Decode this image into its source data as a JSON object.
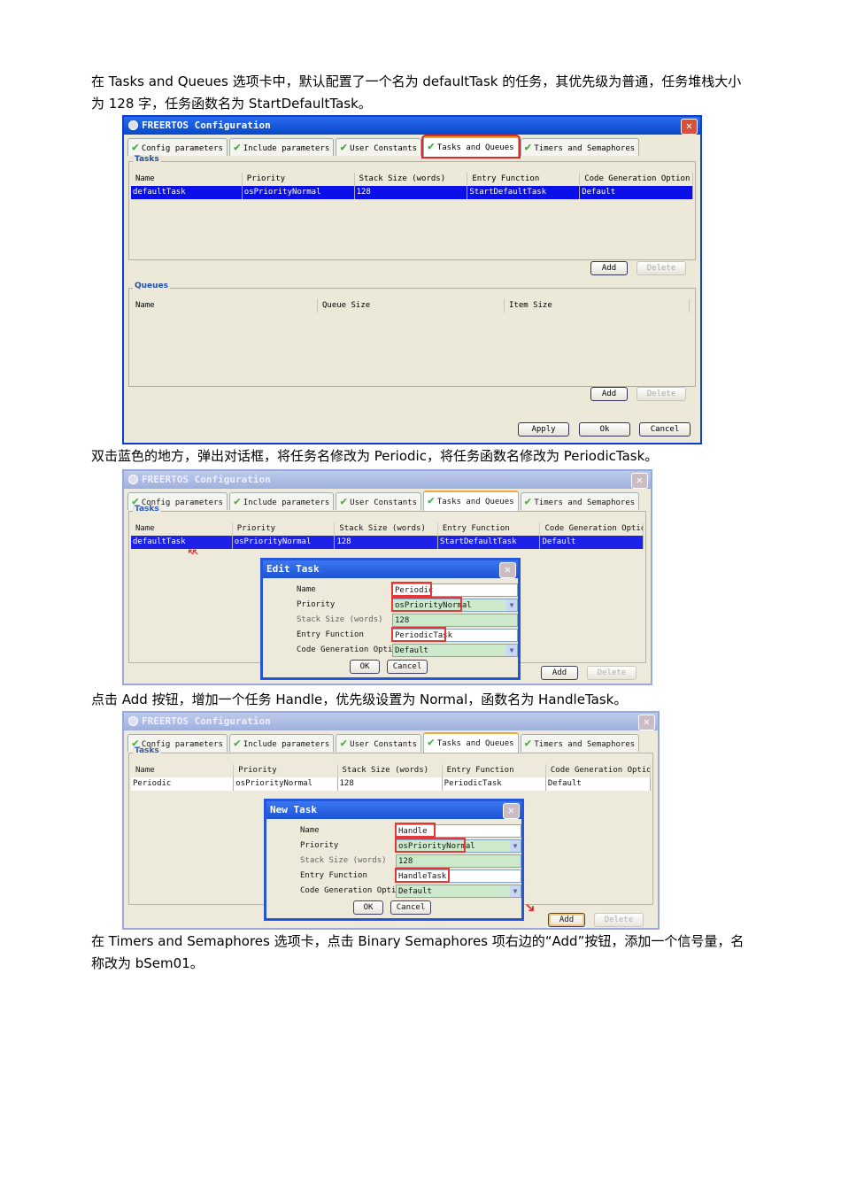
{
  "paragraphs": [
    "在 Tasks and Queues 选项卡中，默认配置了一个名为 defaultTask 的任务，其优先级为普通，任务堆栈大小为 128 字，任务函数名为 StartDefaultTask。",
    "双击蓝色的地方，弹出对话框，将任务名修改为 Periodic，将任务函数名修改为 PeriodicTask。",
    "点击 Add 按钮，增加一个任务 Handle，优先级设置为 Normal，函数名为 HandleTask。",
    "在 Timers and Semaphores  选项卡，点击 Binary Semaphores 项右边的“Add”按钮，添加一个信号量，名称改为 bSem01。"
  ],
  "window_title": "FREERTOS Configuration",
  "close_glyph": "✕",
  "tabs": [
    "Config parameters",
    "Include parameters",
    "User Constants",
    "Tasks and Queues",
    "Timers and Semaphores"
  ],
  "check_glyph": "✔",
  "tasks_label": "Tasks",
  "queues_label": "Queues",
  "task_columns": [
    "Name",
    "Priority",
    "Stack Size (words)",
    "Entry Function",
    "Code Generation Option"
  ],
  "queue_columns": [
    "Name",
    "Queue Size",
    "Item Size"
  ],
  "add_label": "Add",
  "delete_label": "Delete",
  "apply_label": "Apply",
  "ok_label": "Ok",
  "cancel_label": "Cancel",
  "dialog_ok": "OK",
  "dialog_cancel": "Cancel",
  "dropdown_glyph": "▼",
  "field_labels": [
    "Name",
    "Priority",
    "Stack Size (words)",
    "Entry Function",
    "Code Generation Option"
  ],
  "screens": [
    {
      "tasks": [
        [
          "defaultTask",
          "osPriorityNormal",
          "128",
          "StartDefaultTask",
          "Default"
        ]
      ],
      "selected": true
    },
    {
      "tasks": [
        [
          "defaultTask",
          "osPriorityNormal",
          "128",
          "StartDefaultTask",
          "Default"
        ]
      ],
      "selected": true,
      "dialog": {
        "title": "Edit Task",
        "values": [
          "Periodic",
          "osPriorityNormal",
          "128",
          "PeriodicTask",
          "Default"
        ]
      }
    },
    {
      "tasks": [
        [
          "Periodic",
          "osPriorityNormal",
          "128",
          "PeriodicTask",
          "Default"
        ]
      ],
      "selected": false,
      "dialog": {
        "title": "New Task",
        "values": [
          "Handle",
          "osPriorityNormal",
          "128",
          "HandleTask",
          "Default"
        ]
      }
    }
  ],
  "colors": {
    "highlight": "#e02828",
    "selection": "#0b10e8"
  }
}
